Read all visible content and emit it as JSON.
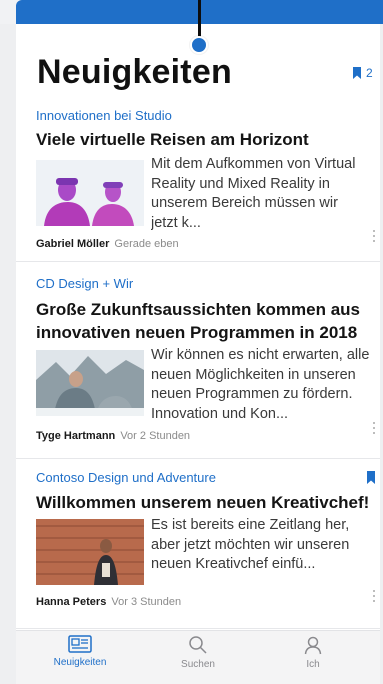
{
  "header": {
    "title": "Neuigkeiten",
    "saved_count": "2"
  },
  "articles": [
    {
      "category": "Innovationen bei Studio",
      "headline": "Viele virtuelle Reisen am Horizont",
      "excerpt": "Mit dem Aufkommen von Virtual\nReality und Mixed Reality in\nunserem Bereich müssen wir\njetzt k...",
      "author": "Gabriel Möller",
      "time": "Gerade eben",
      "bookmarked": false
    },
    {
      "category": "CD Design + Wir",
      "headline": "Große Zukunftsaussichten kommen aus innovativen neuen Programmen in 2018",
      "excerpt": "Wir können es nicht erwarten, alle\nneuen Möglichkeiten in unseren\nneuen Programmen zu fördern.\nInnovation und Kon...",
      "author": "Tyge Hartmann",
      "time": "Vor 2 Stunden",
      "bookmarked": false
    },
    {
      "category": "Contoso Design und Adventure",
      "headline": "Willkommen unserem neuen Kreativchef!",
      "excerpt": "Es ist bereits eine Zeitlang her,\naber jetzt möchten wir unseren\nneuen Kreativchef einfü...",
      "author": "Hanna Peters",
      "time": "Vor 3 Stunden",
      "bookmarked": true
    }
  ],
  "tabs": [
    {
      "label": "Neuigkeiten",
      "icon": "news-icon",
      "active": true
    },
    {
      "label": "Suchen",
      "icon": "search-icon",
      "active": false
    },
    {
      "label": "Ich",
      "icon": "person-icon",
      "active": false
    }
  ],
  "colors": {
    "accent": "#1f6fc8",
    "text": "#141414",
    "muted": "#8b8b8b"
  }
}
